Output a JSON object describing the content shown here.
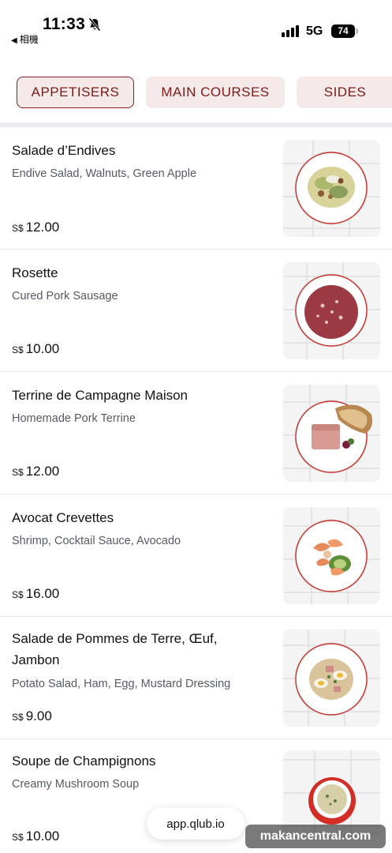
{
  "status_bar": {
    "time": "11:33",
    "back_label": "相機",
    "network": "5G",
    "battery": "74",
    "icons": [
      "bell-slash-icon",
      "signal-icon",
      "battery-icon"
    ]
  },
  "tabs": [
    {
      "label": "APPETISERS",
      "active": true
    },
    {
      "label": "MAIN COURSES",
      "active": false
    },
    {
      "label": "SIDES",
      "active": false
    }
  ],
  "currency": "S$",
  "items": [
    {
      "name": "Salade d’Endives",
      "description": "Endive Salad, Walnuts, Green Apple",
      "price": "12.00",
      "image": "endive-salad"
    },
    {
      "name": "Rosette",
      "description": "Cured Pork Sausage",
      "price": "10.00",
      "image": "cured-sausage"
    },
    {
      "name": "Terrine de Campagne Maison",
      "description": "Homemade Pork Terrine",
      "price": "12.00",
      "image": "pork-terrine"
    },
    {
      "name": "Avocat Crevettes",
      "description": "Shrimp, Cocktail Sauce, Avocado",
      "price": "16.00",
      "image": "shrimp-avocado"
    },
    {
      "name": "Salade de Pommes de Terre, Œuf, Jambon",
      "description": "Potato Salad, Ham, Egg, Mustard Dressing",
      "price": "9.00",
      "image": "potato-salad"
    },
    {
      "name": "Soupe de Champignons",
      "description": "Creamy Mushroom Soup",
      "price": "10.00",
      "image": "mushroom-soup"
    }
  ],
  "footer": {
    "url": "app.qlub.io",
    "watermark": "makancentral.com"
  },
  "colors": {
    "accent": "#8a1f1a",
    "tab_bg": "#f6e9e9",
    "plate_rim": "#c8332c"
  }
}
